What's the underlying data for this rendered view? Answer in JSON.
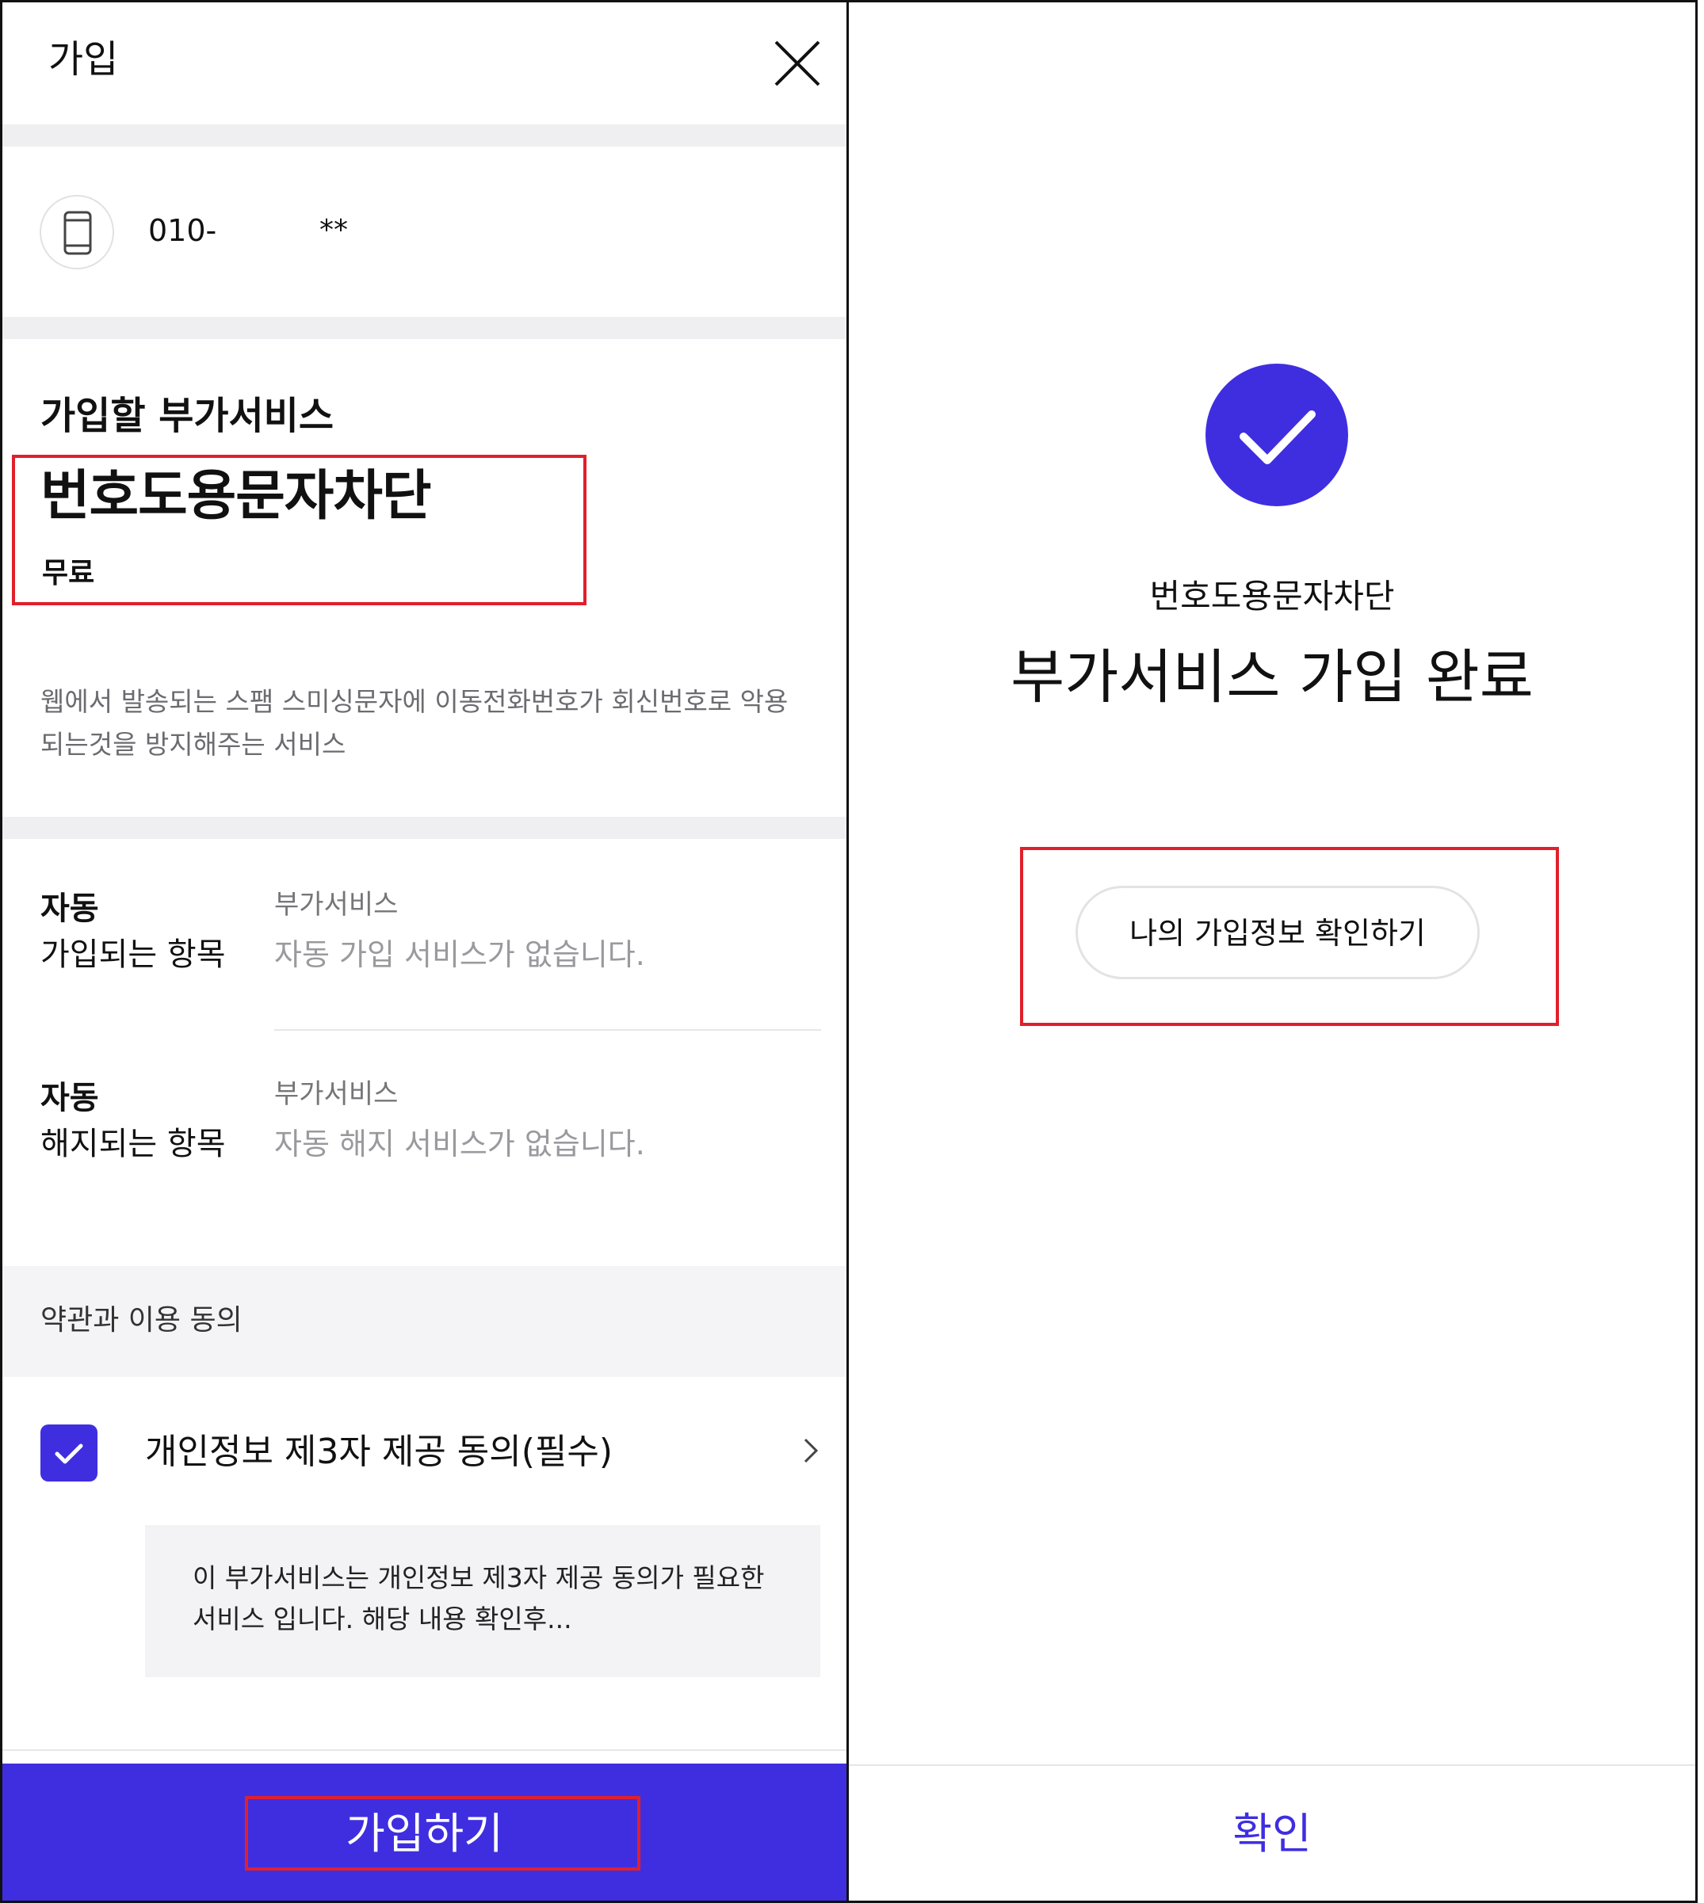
{
  "join_screen": {
    "title": "가입",
    "close_icon": "close-icon",
    "phone_icon": "smartphone-icon",
    "phone_number": "010-",
    "phone_mask": "**",
    "service": {
      "heading": "가입할 부가서비스",
      "name": "번호도용문자차단",
      "price": "무료",
      "description": "웹에서 발송되는 스팸 스미싱문자에 이동전화번호가 회신번호로 악용되는것을 방지해주는 서비스"
    },
    "auto_join": {
      "title_line1": "자동",
      "title_line2": "가입되는 항목",
      "label": "부가서비스",
      "value": "자동 가입 서비스가 없습니다."
    },
    "auto_cancel": {
      "title_line1": "자동",
      "title_line2": "해지되는 항목",
      "label": "부가서비스",
      "value": "자동 해지 서비스가 없습니다."
    },
    "terms": {
      "section_label": "약관과 이용 동의",
      "agree_label": "개인정보 제3자 제공 동의(필수)",
      "checked": true,
      "info_text": "이 부가서비스는 개인정보 제3자 제공 동의가 필요한 서비스 입니다. 해당 내용 확인후..."
    },
    "join_button": "가입하기"
  },
  "complete_screen": {
    "check_icon": "check-circle-icon",
    "service_name": "번호도용문자차단",
    "message": "부가서비스 가입 완료",
    "info_button": "나의 가입정보 확인하기",
    "confirm_button": "확인"
  },
  "colors": {
    "accent": "#3f2ee0",
    "highlight_box": "#e0202b",
    "section_gap": "#efeff1"
  }
}
